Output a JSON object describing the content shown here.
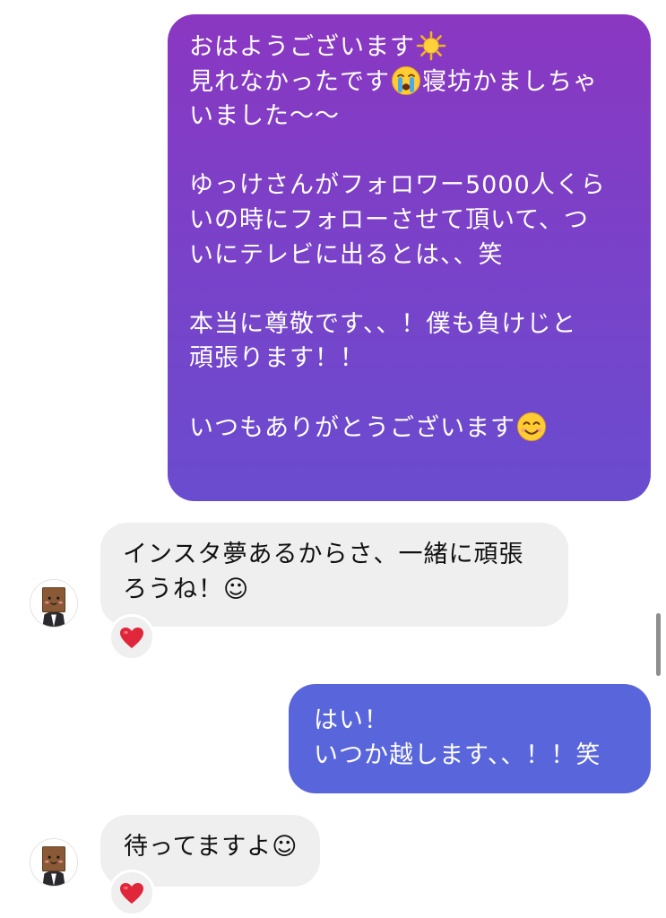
{
  "messages": [
    {
      "direction": "outgoing",
      "lines": [
        "おはようございます",
        "見れなかったです",
        "寝坊かましちゃ",
        "いました〜〜",
        "",
        "ゆっけさんがフォロワー5000人くら",
        "いの時にフォローさせて頂いて、つ",
        "いにテレビに出るとは、、笑",
        "",
        "本当に尊敬です、、！僕も負けじと",
        "頑張ります！！",
        "",
        "いつもありがとうございます"
      ],
      "emojis": [
        "sun-emoji",
        "crying-face-emoji",
        "smiling-face-emoji"
      ]
    },
    {
      "direction": "incoming",
      "lines": [
        "インスタ夢あるからさ、一緒に頑張",
        "ろうね！☺"
      ],
      "reaction": "red-heart"
    },
    {
      "direction": "outgoing",
      "lines": [
        "はい！",
        "いつか越します、、！！笑"
      ]
    },
    {
      "direction": "incoming",
      "lines": [
        "待ってますよ☺"
      ],
      "reaction": "red-heart"
    }
  ],
  "colors": {
    "outgoing_gradient_top": "#8a37c2",
    "outgoing_gradient_bottom": "#6a4ccf",
    "outgoing_solid": "#5966db",
    "incoming_bg": "#efefef",
    "heart": "#e0263a"
  }
}
